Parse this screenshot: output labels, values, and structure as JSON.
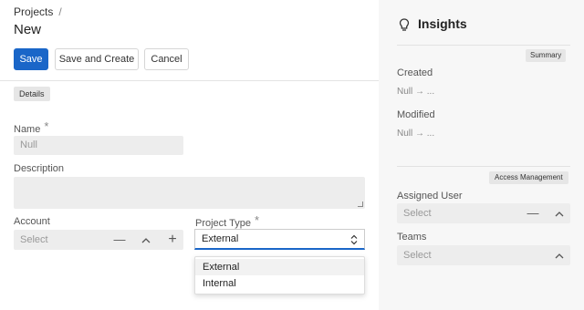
{
  "breadcrumb": {
    "parent": "Projects",
    "separator": "/"
  },
  "page_title": "New",
  "toolbar": {
    "save": "Save",
    "save_and_create": "Save and Create",
    "cancel": "Cancel"
  },
  "form": {
    "section_tag": "Details",
    "name": {
      "label": "Name",
      "required": "*",
      "placeholder": "Null"
    },
    "description": {
      "label": "Description"
    },
    "account": {
      "label": "Account",
      "placeholder": "Select"
    },
    "project_type": {
      "label": "Project Type",
      "required": "*",
      "value": "External",
      "options": [
        "External",
        "Internal"
      ]
    }
  },
  "insights": {
    "title": "Insights",
    "summary_tag": "Summary",
    "created": {
      "label": "Created",
      "value": "Null → ..."
    },
    "modified": {
      "label": "Modified",
      "value": "Null → ..."
    },
    "access_tag": "Access Management",
    "assigned_user": {
      "label": "Assigned User",
      "placeholder": "Select"
    },
    "teams": {
      "label": "Teams",
      "placeholder": "Select"
    }
  },
  "colors": {
    "primary": "#1a66c8",
    "field_bg": "#ededed",
    "side_bg": "#f7f7f7"
  },
  "icons": [
    "lightbulb-icon",
    "minus-icon",
    "chevron-up-icon",
    "plus-icon",
    "up-down-chevron-icon"
  ]
}
